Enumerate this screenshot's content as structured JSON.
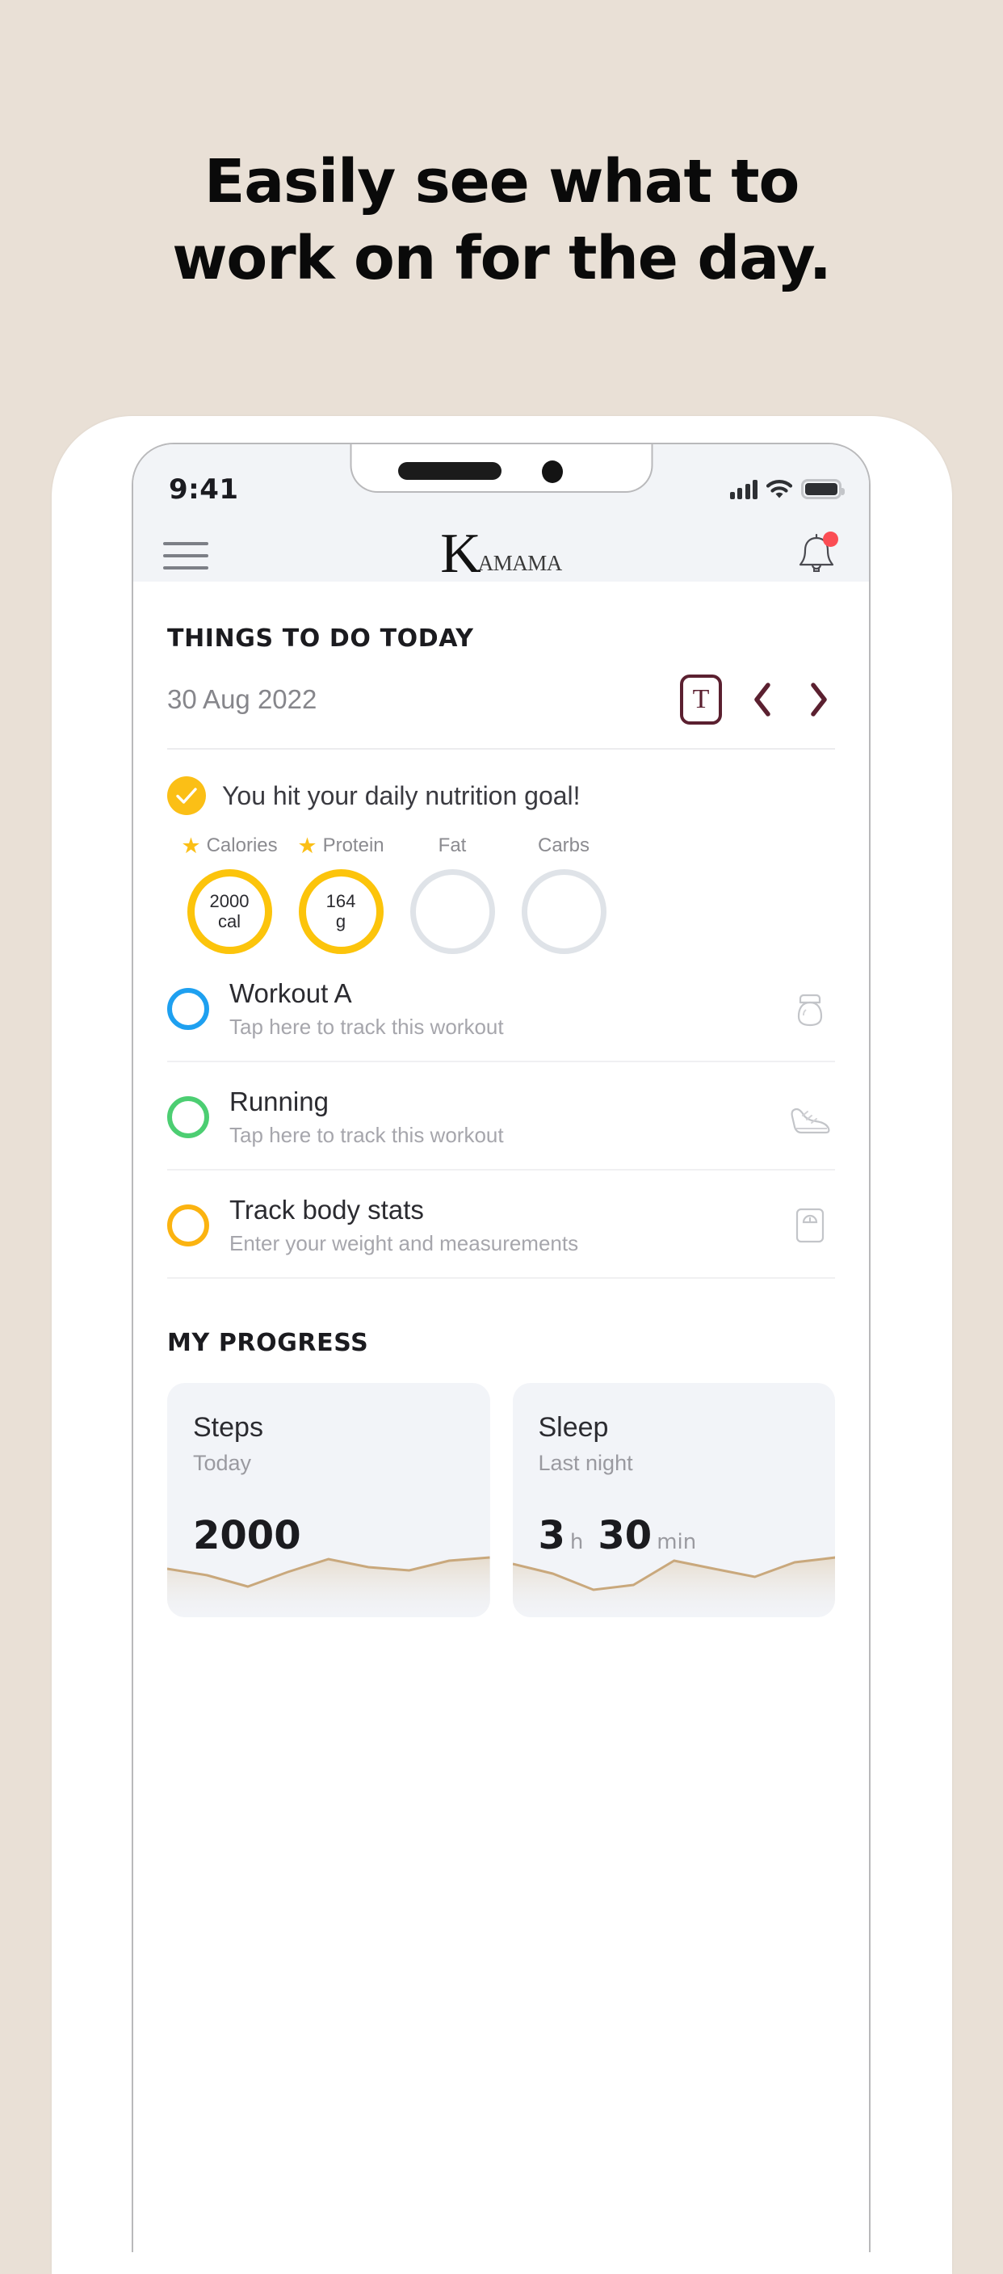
{
  "promo": {
    "headline_line1": "Easily see what to",
    "headline_line2": "work on for the day.",
    "background_color": "#e9e0d6"
  },
  "status_bar": {
    "time": "9:41",
    "icons": [
      "cellular-signal-icon",
      "wifi-icon",
      "battery-icon"
    ]
  },
  "nav": {
    "menu_icon": "hamburger-menu-icon",
    "brand_initial": "K",
    "brand_rest": "AMAMA",
    "notification_icon": "bell-icon",
    "has_notification_dot": true
  },
  "today": {
    "section_title": "THINGS TO DO TODAY",
    "date": "30 Aug 2022",
    "today_button_label": "T",
    "prev_label": "‹",
    "next_label": "›",
    "accent_color": "#5b2030"
  },
  "nutrition": {
    "goal_message": "You hit your daily nutrition goal!",
    "check_icon": "check-circle-icon",
    "rings": [
      {
        "label": "Calories",
        "starred": true,
        "value": "2000",
        "unit": "cal",
        "state": "active"
      },
      {
        "label": "Protein",
        "starred": true,
        "value": "164",
        "unit": "g",
        "state": "active"
      },
      {
        "label": "Fat",
        "starred": false,
        "value": "",
        "unit": "",
        "state": "empty"
      },
      {
        "label": "Carbs",
        "starred": false,
        "value": "",
        "unit": "",
        "state": "empty"
      }
    ],
    "active_color": "#fcc40b",
    "empty_color": "#dfe3e8"
  },
  "tasks": [
    {
      "title": "Workout A",
      "subtitle": "Tap here to track this workout",
      "circle_color": "#1ea0f0",
      "icon": "kettlebell-icon"
    },
    {
      "title": "Running",
      "subtitle": "Tap here to track this workout",
      "circle_color": "#4cce72",
      "icon": "running-shoe-icon"
    },
    {
      "title": "Track body stats",
      "subtitle": "Enter your weight and measurements",
      "circle_color": "#fbb310",
      "icon": "weight-scale-icon"
    }
  ],
  "progress": {
    "section_title": "MY PROGRESS",
    "cards": [
      {
        "title": "Steps",
        "subtitle": "Today",
        "value": "2000",
        "unit": "",
        "value2": "",
        "unit2": ""
      },
      {
        "title": "Sleep",
        "subtitle": "Last night",
        "value": "3",
        "unit": "h",
        "value2": "30",
        "unit2": "min"
      }
    ],
    "sparkline_color": "#c9a87c"
  },
  "chart_data": [
    {
      "type": "area",
      "title": "Steps",
      "x": [
        0,
        1,
        2,
        3,
        4,
        5,
        6,
        7,
        8
      ],
      "values": [
        62,
        48,
        30,
        55,
        74,
        62,
        58,
        72,
        78
      ],
      "ylim": [
        0,
        100
      ],
      "xlabel": "",
      "ylabel": "",
      "grid": false,
      "legend": "none"
    },
    {
      "type": "area",
      "title": "Sleep",
      "x": [
        0,
        1,
        2,
        3,
        4,
        5,
        6,
        7,
        8
      ],
      "values": [
        70,
        58,
        34,
        40,
        76,
        66,
        54,
        74,
        80
      ],
      "ylim": [
        0,
        100
      ],
      "xlabel": "",
      "ylabel": "",
      "grid": false,
      "legend": "none"
    }
  ]
}
